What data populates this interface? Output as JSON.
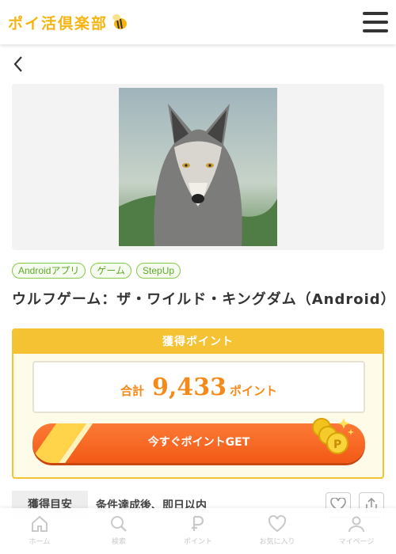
{
  "header": {
    "logo_text": "ポイ活倶楽部",
    "menu_icon": "hamburger-icon"
  },
  "nav": {
    "back_icon": "chevron-left-icon"
  },
  "hero": {
    "image": "wolf-photo"
  },
  "tags": [
    "Androidアプリ",
    "ゲーム",
    "StepUp"
  ],
  "title": "ウルフゲーム：ザ・ワイルド・キングダム（Android）",
  "points": {
    "heading": "獲得ポイント",
    "total_label": "合計",
    "total_value": "9,433",
    "unit": "ポイント",
    "cta_label": "今すぐポイントGET"
  },
  "eta": {
    "label": "獲得目安",
    "value": "条件達成後、即日以内"
  },
  "actions": {
    "favorite_icon": "heart-icon",
    "share_icon": "share-icon"
  },
  "tabbar": [
    {
      "label": "ホーム",
      "icon": "home-icon"
    },
    {
      "label": "検索",
      "icon": "search-icon"
    },
    {
      "label": "ポイント",
      "icon": "point-icon"
    },
    {
      "label": "お気に入り",
      "icon": "heart-icon"
    },
    {
      "label": "マイページ",
      "icon": "user-icon"
    }
  ],
  "colors": {
    "brand": "#f5b40f",
    "accent_orange": "#f25a16",
    "tag_green": "#88c94a"
  }
}
